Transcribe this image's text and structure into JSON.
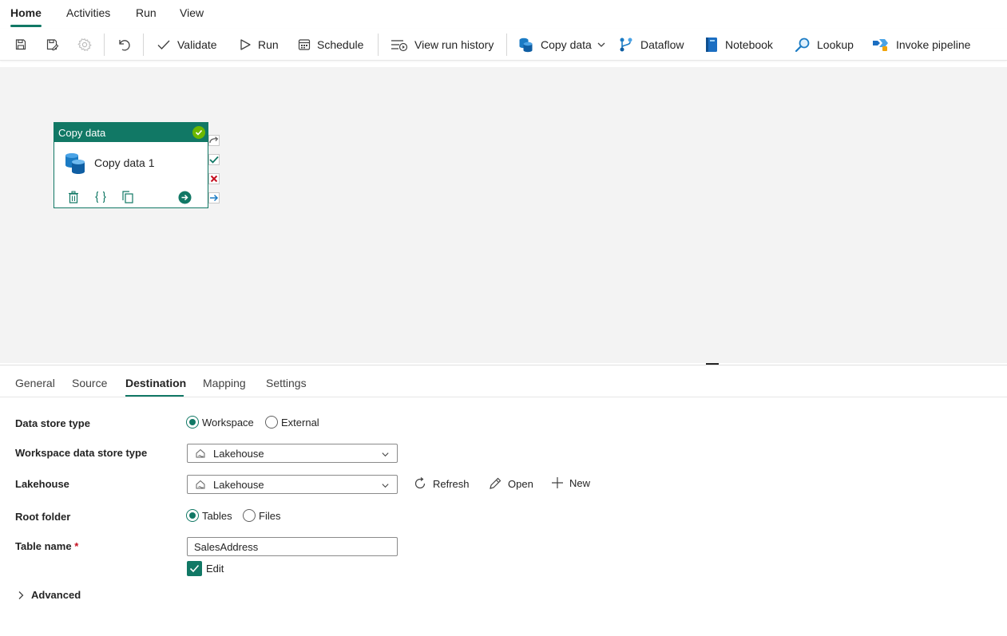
{
  "menu": {
    "tabs": [
      {
        "label": "Home",
        "active": true
      },
      {
        "label": "Activities"
      },
      {
        "label": "Run"
      },
      {
        "label": "View"
      }
    ]
  },
  "toolbar": {
    "save_icon": "save-icon",
    "save_as_icon": "save-as-icon",
    "settings_icon": "gear-icon",
    "undo_icon": "undo-icon",
    "validate": "Validate",
    "run": "Run",
    "schedule": "Schedule",
    "view_run_history": "View run history",
    "copy_data": "Copy data",
    "dataflow": "Dataflow",
    "notebook": "Notebook",
    "lookup": "Lookup",
    "invoke_pipeline": "Invoke pipeline"
  },
  "canvas": {
    "activity": {
      "type_label": "Copy data",
      "name": "Copy data 1",
      "status": "succeeded"
    }
  },
  "properties": {
    "tabs": [
      {
        "label": "General"
      },
      {
        "label": "Source"
      },
      {
        "label": "Destination",
        "active": true
      },
      {
        "label": "Mapping"
      },
      {
        "label": "Settings"
      }
    ],
    "data_store_type": {
      "label": "Data store type",
      "options": [
        "Workspace",
        "External"
      ],
      "selected": "Workspace"
    },
    "workspace_data_store_type": {
      "label": "Workspace data store type",
      "value": "Lakehouse"
    },
    "lakehouse": {
      "label": "Lakehouse",
      "value": "Lakehouse",
      "refresh": "Refresh",
      "open": "Open",
      "new": "New"
    },
    "root_folder": {
      "label": "Root folder",
      "options": [
        "Tables",
        "Files"
      ],
      "selected": "Tables"
    },
    "table_name": {
      "label": "Table name",
      "required_mark": "*",
      "value": "SalesAddress",
      "edit_label": "Edit",
      "edit_checked": true
    },
    "advanced": "Advanced"
  },
  "colors": {
    "accent": "#117865",
    "canvas_bg": "#f3f3f3",
    "success": "#6bb700",
    "error": "#c50f1f"
  }
}
